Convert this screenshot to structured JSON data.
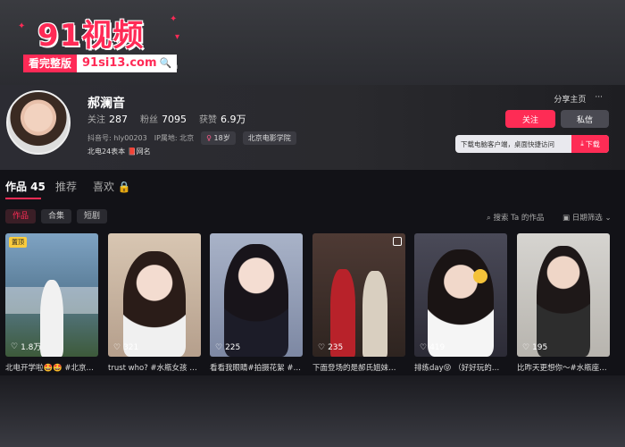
{
  "banner": {
    "logo_text": "91视频",
    "tag": "看完整版",
    "url": "91si13.com",
    "accent": "#ff2a56"
  },
  "profile": {
    "name": "郝澜音",
    "stats": [
      {
        "label": "关注",
        "value": "287"
      },
      {
        "label": "粉丝",
        "value": "7095"
      },
      {
        "label": "获赞",
        "value": "6.9万"
      }
    ],
    "meta": {
      "account": "抖音号: hly00203",
      "ip": "IP属地: 北京",
      "age": "18岁",
      "school": "北京电影学院"
    },
    "bio": "北电24表本 📕网名",
    "share_label": "分享主页",
    "more_label": "···",
    "follow_label": "关注",
    "message_label": "私信",
    "download_text": "下载电脑客户端，桌面快捷访问",
    "download_btn": "下载"
  },
  "tabs": [
    {
      "label": "作品 45",
      "active": true
    },
    {
      "label": "推荐",
      "active": false
    },
    {
      "label": "喜欢 🔒",
      "active": false
    }
  ],
  "subtabs": [
    {
      "label": "作品",
      "active": true
    },
    {
      "label": "合集",
      "active": false
    },
    {
      "label": "短剧",
      "active": false
    }
  ],
  "search_link": "搜索 Ta 的作品",
  "date_filter": "日期筛选",
  "videos": [
    {
      "likes": "1.8万",
      "caption": "北电开学啦🤩🤩 #北京…",
      "pinned_label": "置顶",
      "multi": false,
      "bg": "#5c7f9a"
    },
    {
      "likes": "321",
      "caption": "trust who? #水瓶女孩 …",
      "pinned_label": "",
      "multi": false,
      "bg": "#c9b7a6"
    },
    {
      "likes": "225",
      "caption": "看看我眼睛#拍摄花絮 #…",
      "pinned_label": "",
      "multi": false,
      "bg": "#8c98b5"
    },
    {
      "likes": "235",
      "caption": "下面登场的是郝氏姐妹…",
      "pinned_label": "",
      "multi": true,
      "bg": "#6e4e46"
    },
    {
      "likes": "419",
      "caption": "排练day😝 （好好玩的…",
      "pinned_label": "",
      "multi": false,
      "bg": "#3f3d4e"
    },
    {
      "likes": "195",
      "caption": "比昨天更想你～#水瓶座…",
      "pinned_label": "",
      "multi": false,
      "bg": "#c8c6c2"
    }
  ],
  "colors": {
    "accent": "#fe2c55",
    "background": "#121217"
  }
}
